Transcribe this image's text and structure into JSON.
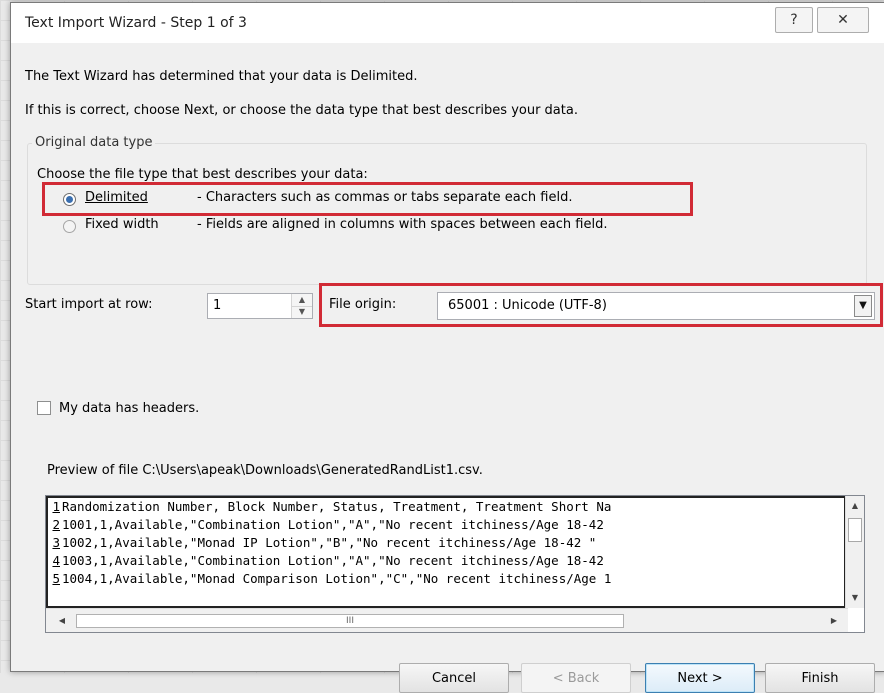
{
  "window": {
    "title": "Text Import Wizard - Step 1 of 3",
    "help_glyph": "?",
    "close_glyph": "✕"
  },
  "intro": {
    "line1": "The Text Wizard has determined that your data is Delimited.",
    "line2": "If this is correct, choose Next, or choose the data type that best describes your data."
  },
  "original_data_type": {
    "legend": "Original data type",
    "prompt": "Choose the file type that best describes your data:",
    "options": [
      {
        "label": "Delimited",
        "description": "- Characters such as commas or tabs separate each field.",
        "selected": true
      },
      {
        "label": "Fixed width",
        "description": "- Fields are aligned in columns with spaces between each field.",
        "selected": false
      }
    ]
  },
  "start_row": {
    "label": "Start import at row:",
    "value": "1"
  },
  "file_origin": {
    "label": "File origin:",
    "value": "65001 : Unicode (UTF-8)"
  },
  "headers_checkbox": {
    "label": "My data has headers.",
    "checked": false
  },
  "preview": {
    "label": "Preview of file C:\\Users\\apeak\\Downloads\\GeneratedRandList1.csv.",
    "lines": [
      {
        "num": "1",
        "text": "Randomization Number, Block Number, Status, Treatment, Treatment Short Na"
      },
      {
        "num": "2",
        "text": "1001,1,Available,\"Combination Lotion\",\"A\",\"No recent itchiness/Age 18-42"
      },
      {
        "num": "3",
        "text": "1002,1,Available,\"Monad IP Lotion\",\"B\",\"No recent itchiness/Age 18-42 \""
      },
      {
        "num": "4",
        "text": "1003,1,Available,\"Combination Lotion\",\"A\",\"No recent itchiness/Age 18-42"
      },
      {
        "num": "5",
        "text": "1004,1,Available,\"Monad Comparison Lotion\",\"C\",\"No recent itchiness/Age 1"
      }
    ],
    "hscroll_grip": "III"
  },
  "buttons": {
    "cancel": "Cancel",
    "back": "< Back",
    "next": "Next >",
    "finish": "Finish"
  },
  "colors": {
    "highlight_box": "#d12a35",
    "radio_selected": "#3a6fb0"
  }
}
